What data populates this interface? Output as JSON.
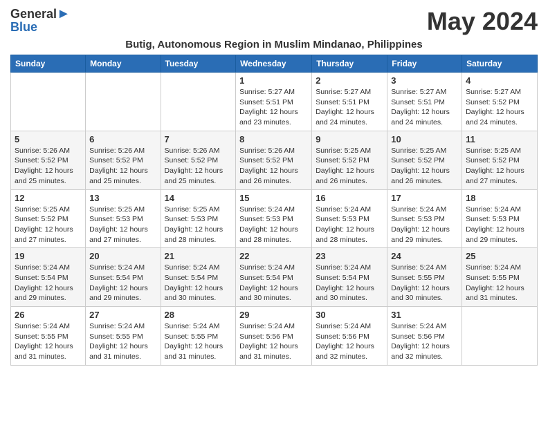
{
  "header": {
    "logo_general": "General",
    "logo_blue": "Blue",
    "month_year": "May 2024",
    "location": "Butig, Autonomous Region in Muslim Mindanao, Philippines"
  },
  "weekdays": [
    "Sunday",
    "Monday",
    "Tuesday",
    "Wednesday",
    "Thursday",
    "Friday",
    "Saturday"
  ],
  "weeks": [
    [
      {
        "day": "",
        "info": ""
      },
      {
        "day": "",
        "info": ""
      },
      {
        "day": "",
        "info": ""
      },
      {
        "day": "1",
        "info": "Sunrise: 5:27 AM\nSunset: 5:51 PM\nDaylight: 12 hours\nand 23 minutes."
      },
      {
        "day": "2",
        "info": "Sunrise: 5:27 AM\nSunset: 5:51 PM\nDaylight: 12 hours\nand 24 minutes."
      },
      {
        "day": "3",
        "info": "Sunrise: 5:27 AM\nSunset: 5:51 PM\nDaylight: 12 hours\nand 24 minutes."
      },
      {
        "day": "4",
        "info": "Sunrise: 5:27 AM\nSunset: 5:52 PM\nDaylight: 12 hours\nand 24 minutes."
      }
    ],
    [
      {
        "day": "5",
        "info": "Sunrise: 5:26 AM\nSunset: 5:52 PM\nDaylight: 12 hours\nand 25 minutes."
      },
      {
        "day": "6",
        "info": "Sunrise: 5:26 AM\nSunset: 5:52 PM\nDaylight: 12 hours\nand 25 minutes."
      },
      {
        "day": "7",
        "info": "Sunrise: 5:26 AM\nSunset: 5:52 PM\nDaylight: 12 hours\nand 25 minutes."
      },
      {
        "day": "8",
        "info": "Sunrise: 5:26 AM\nSunset: 5:52 PM\nDaylight: 12 hours\nand 26 minutes."
      },
      {
        "day": "9",
        "info": "Sunrise: 5:25 AM\nSunset: 5:52 PM\nDaylight: 12 hours\nand 26 minutes."
      },
      {
        "day": "10",
        "info": "Sunrise: 5:25 AM\nSunset: 5:52 PM\nDaylight: 12 hours\nand 26 minutes."
      },
      {
        "day": "11",
        "info": "Sunrise: 5:25 AM\nSunset: 5:52 PM\nDaylight: 12 hours\nand 27 minutes."
      }
    ],
    [
      {
        "day": "12",
        "info": "Sunrise: 5:25 AM\nSunset: 5:52 PM\nDaylight: 12 hours\nand 27 minutes."
      },
      {
        "day": "13",
        "info": "Sunrise: 5:25 AM\nSunset: 5:53 PM\nDaylight: 12 hours\nand 27 minutes."
      },
      {
        "day": "14",
        "info": "Sunrise: 5:25 AM\nSunset: 5:53 PM\nDaylight: 12 hours\nand 28 minutes."
      },
      {
        "day": "15",
        "info": "Sunrise: 5:24 AM\nSunset: 5:53 PM\nDaylight: 12 hours\nand 28 minutes."
      },
      {
        "day": "16",
        "info": "Sunrise: 5:24 AM\nSunset: 5:53 PM\nDaylight: 12 hours\nand 28 minutes."
      },
      {
        "day": "17",
        "info": "Sunrise: 5:24 AM\nSunset: 5:53 PM\nDaylight: 12 hours\nand 29 minutes."
      },
      {
        "day": "18",
        "info": "Sunrise: 5:24 AM\nSunset: 5:53 PM\nDaylight: 12 hours\nand 29 minutes."
      }
    ],
    [
      {
        "day": "19",
        "info": "Sunrise: 5:24 AM\nSunset: 5:54 PM\nDaylight: 12 hours\nand 29 minutes."
      },
      {
        "day": "20",
        "info": "Sunrise: 5:24 AM\nSunset: 5:54 PM\nDaylight: 12 hours\nand 29 minutes."
      },
      {
        "day": "21",
        "info": "Sunrise: 5:24 AM\nSunset: 5:54 PM\nDaylight: 12 hours\nand 30 minutes."
      },
      {
        "day": "22",
        "info": "Sunrise: 5:24 AM\nSunset: 5:54 PM\nDaylight: 12 hours\nand 30 minutes."
      },
      {
        "day": "23",
        "info": "Sunrise: 5:24 AM\nSunset: 5:54 PM\nDaylight: 12 hours\nand 30 minutes."
      },
      {
        "day": "24",
        "info": "Sunrise: 5:24 AM\nSunset: 5:55 PM\nDaylight: 12 hours\nand 30 minutes."
      },
      {
        "day": "25",
        "info": "Sunrise: 5:24 AM\nSunset: 5:55 PM\nDaylight: 12 hours\nand 31 minutes."
      }
    ],
    [
      {
        "day": "26",
        "info": "Sunrise: 5:24 AM\nSunset: 5:55 PM\nDaylight: 12 hours\nand 31 minutes."
      },
      {
        "day": "27",
        "info": "Sunrise: 5:24 AM\nSunset: 5:55 PM\nDaylight: 12 hours\nand 31 minutes."
      },
      {
        "day": "28",
        "info": "Sunrise: 5:24 AM\nSunset: 5:55 PM\nDaylight: 12 hours\nand 31 minutes."
      },
      {
        "day": "29",
        "info": "Sunrise: 5:24 AM\nSunset: 5:56 PM\nDaylight: 12 hours\nand 31 minutes."
      },
      {
        "day": "30",
        "info": "Sunrise: 5:24 AM\nSunset: 5:56 PM\nDaylight: 12 hours\nand 32 minutes."
      },
      {
        "day": "31",
        "info": "Sunrise: 5:24 AM\nSunset: 5:56 PM\nDaylight: 12 hours\nand 32 minutes."
      },
      {
        "day": "",
        "info": ""
      }
    ]
  ]
}
